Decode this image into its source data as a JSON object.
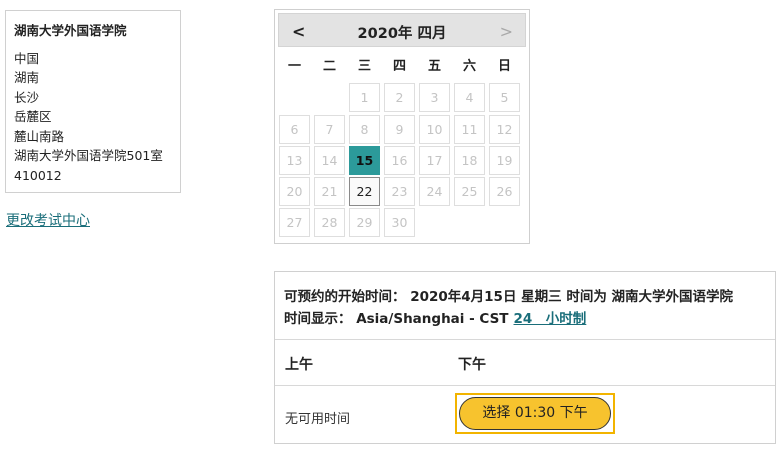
{
  "address": {
    "title": "湖南大学外国语学院",
    "lines": [
      "中国",
      "湖南",
      "长沙",
      "岳麓区",
      "麓山南路",
      "湖南大学外国语学院501室",
      "410012"
    ]
  },
  "change_center_label": "更改考试中心",
  "calendar": {
    "title": "2020年 四月",
    "prev_label": "<",
    "next_label": ">",
    "weekdays": [
      "一",
      "二",
      "三",
      "四",
      "五",
      "六",
      "日"
    ],
    "first_weekday_index": 2,
    "days": [
      "1",
      "2",
      "3",
      "4",
      "5",
      "6",
      "7",
      "8",
      "9",
      "10",
      "11",
      "12",
      "13",
      "14",
      "15",
      "16",
      "17",
      "18",
      "19",
      "20",
      "21",
      "22",
      "23",
      "24",
      "25",
      "26",
      "27",
      "28",
      "29",
      "30"
    ],
    "selected_day": "15",
    "today_day": "22"
  },
  "slots": {
    "available_line": "可预约的开始时间： 2020年4月15日 星期三 时间为 湖南大学外国语学院",
    "timezone_line": "时间显示： Asia/Shanghai - CST",
    "h24_label": "24　小时制",
    "am_label": "上午",
    "pm_label": "下午",
    "no_slot_label": "无可用时间",
    "slot_button_label": "选择 01:30 下午"
  },
  "colors": {
    "selected_day": "#2c9a9a",
    "slot_button": "#f7c32e",
    "link": "#1a6e7a"
  }
}
